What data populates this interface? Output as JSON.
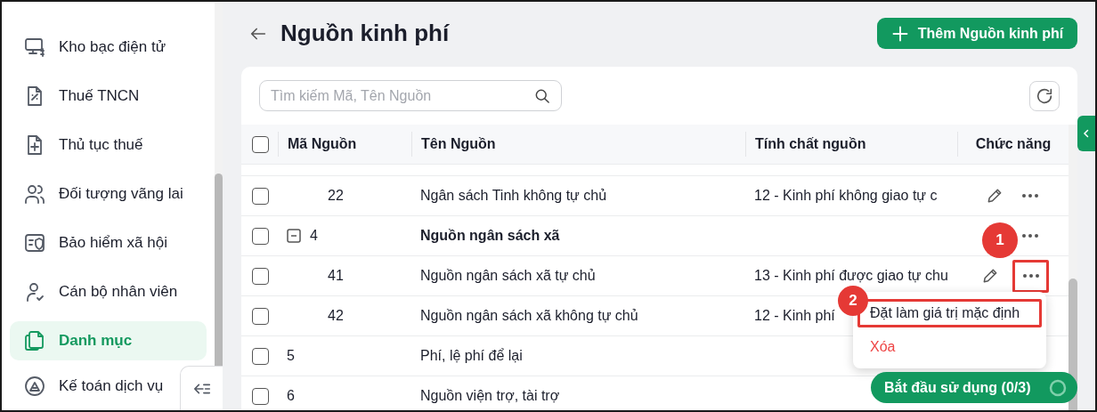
{
  "sidebar": {
    "items": [
      {
        "label": "Kho bạc điện tử",
        "selected": false
      },
      {
        "label": "Thuế TNCN",
        "selected": false
      },
      {
        "label": "Thủ tục thuế",
        "selected": false
      },
      {
        "label": "Đối tượng vãng lai",
        "selected": false
      },
      {
        "label": "Bảo hiểm xã hội",
        "selected": false
      },
      {
        "label": "Cán bộ nhân viên",
        "selected": false
      },
      {
        "label": "Danh mục",
        "selected": true
      },
      {
        "label": "Kế toán dịch vụ",
        "selected": false
      }
    ]
  },
  "page": {
    "title": "Nguồn kinh phí",
    "add_button": "Thêm Nguồn kinh phí"
  },
  "search": {
    "placeholder": "Tìm kiếm Mã, Tên Nguồn"
  },
  "table": {
    "columns": [
      "Mã Nguồn",
      "Tên Nguồn",
      "Tính chất nguồn",
      "Chức năng"
    ],
    "select_all_checked": false,
    "rows": [
      {
        "children": [
          {
            "code": "22",
            "name": "Ngân sách Tinh không tự chủ",
            "property": "12 - Kinh phí không giao tự c",
            "checked": false
          }
        ]
      },
      {
        "code": "4",
        "name": "Nguồn ngân sách xã",
        "checked": false,
        "expanded": true,
        "children": [
          {
            "code": "41",
            "name": "Nguồn ngân sách xã tự chủ",
            "property": "13 - Kinh phí được giao tự chu",
            "checked": false,
            "marked": true
          },
          {
            "code": "42",
            "name": "Nguồn ngân sách xã không tự chủ",
            "property": "12 - Kinh phí",
            "checked": false
          }
        ]
      },
      {
        "code": "5",
        "name": "Phí, lệ phí để lại",
        "checked": false
      },
      {
        "code": "6",
        "name": "Nguồn viện trợ, tài trợ",
        "checked": false
      }
    ]
  },
  "context_menu": {
    "items": [
      {
        "label": "Đặt làm giá trị mặc định",
        "kind": "default",
        "marked": true
      },
      {
        "label": "Xóa",
        "kind": "danger",
        "marked": false
      }
    ]
  },
  "annotations": [
    {
      "label": "1"
    },
    {
      "label": "2"
    }
  ],
  "start_button": {
    "label": "Bắt đầu sử dụng (0/3)"
  }
}
